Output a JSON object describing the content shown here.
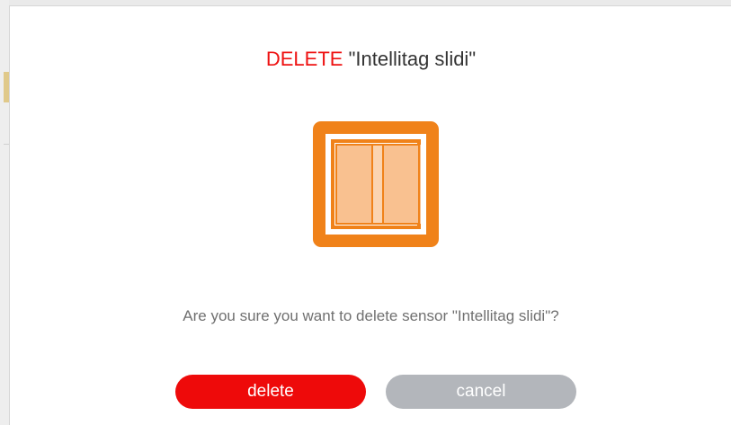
{
  "dialog": {
    "title_action": "DELETE",
    "title_name": "\"Intellitag slidi\"",
    "message": "Are you sure you want to delete sensor \"Intellitag slidi\"?",
    "icon": "sliding-door-sensor-icon",
    "colors": {
      "accent_red": "#ee0a0a",
      "icon_orange": "#f08219",
      "icon_fill": "#f9c190",
      "cancel_gray": "#b3b6bb"
    }
  },
  "buttons": {
    "delete_label": "delete",
    "cancel_label": "cancel"
  }
}
